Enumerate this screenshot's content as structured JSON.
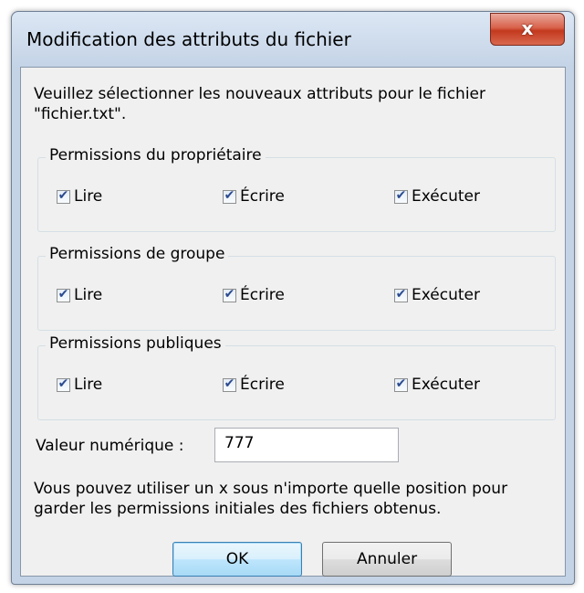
{
  "window": {
    "title": "Modification des attributs du fichier",
    "close_label": "x"
  },
  "intro_text": "Veuillez sélectionner les nouveaux attributs pour le fichier \"fichier.txt\".",
  "groups": [
    {
      "legend": "Permissions du propriétaire",
      "options": [
        {
          "label": "Lire",
          "checked": true
        },
        {
          "label": "Écrire",
          "checked": true
        },
        {
          "label": "Exécuter",
          "checked": true
        }
      ]
    },
    {
      "legend": "Permissions de groupe",
      "options": [
        {
          "label": "Lire",
          "checked": true
        },
        {
          "label": "Écrire",
          "checked": true
        },
        {
          "label": "Exécuter",
          "checked": true
        }
      ]
    },
    {
      "legend": "Permissions publiques",
      "options": [
        {
          "label": "Lire",
          "checked": true
        },
        {
          "label": "Écrire",
          "checked": true
        },
        {
          "label": "Exécuter",
          "checked": true
        }
      ]
    }
  ],
  "numeric": {
    "label": "Valeur numérique :",
    "value": "777"
  },
  "note_text": "Vous pouvez utiliser un x sous n'importe quelle position pour garder les permissions initiales des fichiers obtenus.",
  "buttons": {
    "ok": "OK",
    "cancel": "Annuler"
  },
  "check_glyph": "✔"
}
